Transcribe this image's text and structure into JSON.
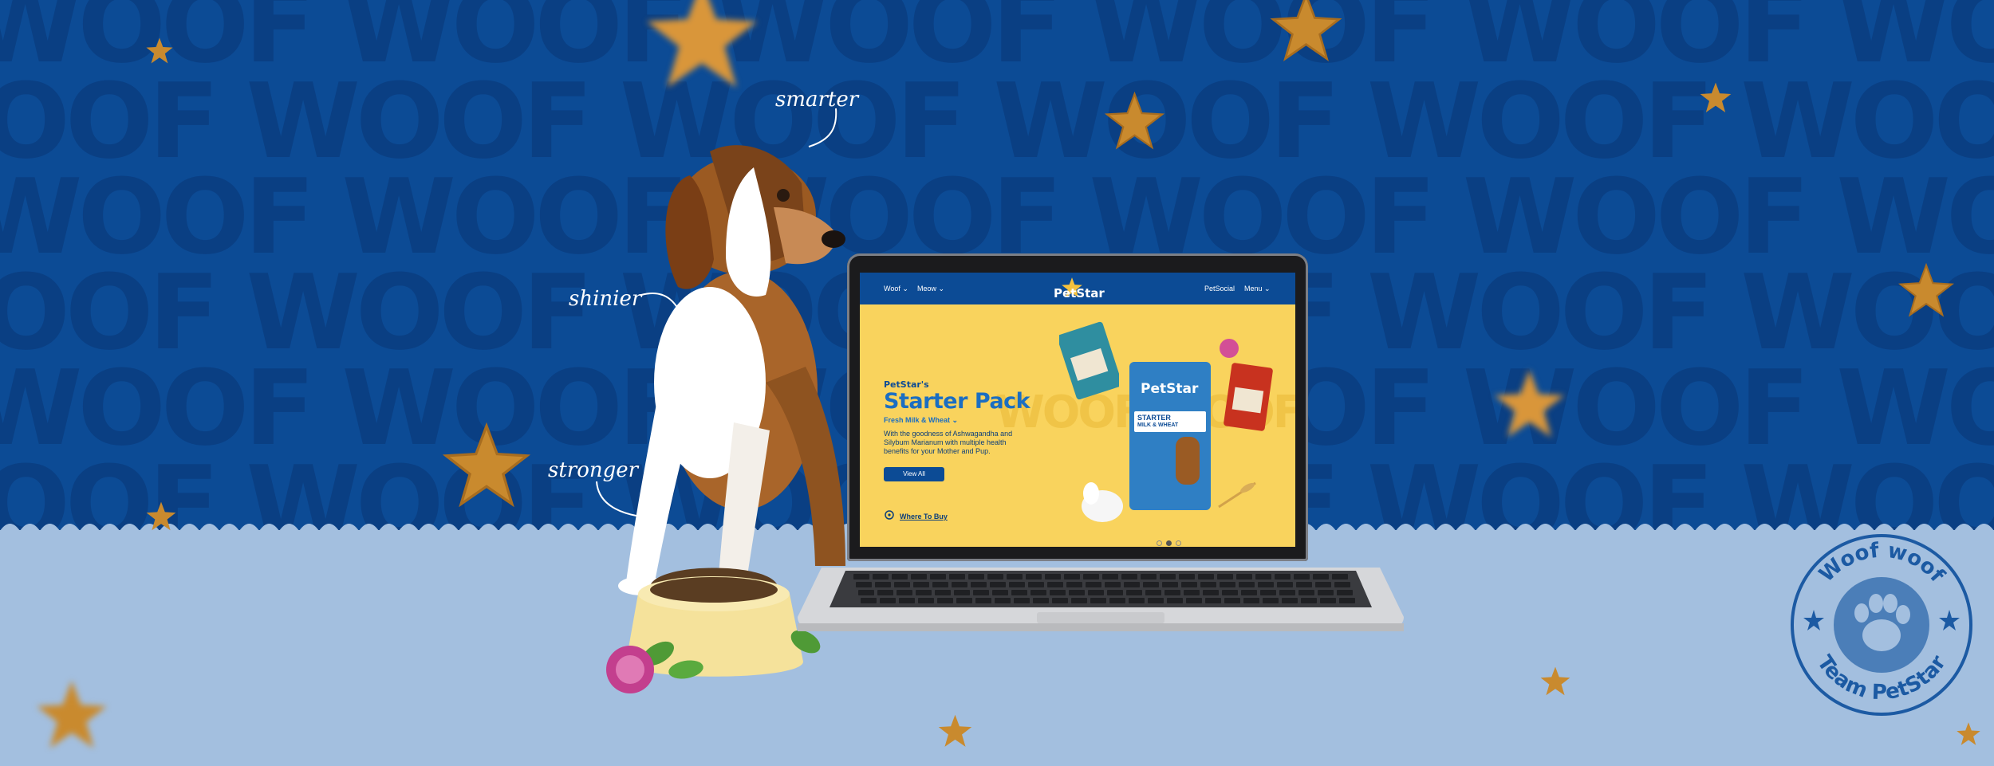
{
  "background": {
    "top_color": "#0c4b95",
    "pattern_color": "#0a3f83",
    "bottom_color": "#a3bfdf",
    "pattern_rows": [
      "WOOF WOOF WOOF WOOF WOOF WOOF WOOF WOOF WOOF WOOF WOOF WOOF WOOF WOOF WOOF WOOF",
      "WOOF WOOF WOOF WOOF WOOF WOOF WOOF WOOF WOOF WOOF WOOF WOOF WOOF WOOF WOOF WOOF",
      "WOOF WOOF WOOF WOOF WOOF WOOF WOOF WOOF WOOF WOOF WOOF WOOF WOOF WOOF WOOF WOOF",
      "WOOF WOOF WOOF WOOF WOOF WOOF WOOF WOOF WOOF WOOF WOOF WOOF WOOF WOOF WOOF WOOF",
      "WOOF WOOF WOOF WOOF WOOF WOOF WOOF WOOF WOOF WOOF WOOF WOOF WOOF WOOF WOOF WOOF",
      "WOOF WOOF WOOF WOOF WOOF WOOF WOOF WOOF WOOF WOOF WOOF WOOF WOOF WOOF WOOF WOOF"
    ]
  },
  "annotations": {
    "smarter": "smarter",
    "shinier": "shinier",
    "stronger": "stronger"
  },
  "website": {
    "nav": {
      "woof": "Woof",
      "meow": "Meow",
      "logo": "PetStar",
      "petsocial": "PetSocial",
      "menu": "Menu"
    },
    "hero": {
      "pretitle": "PetStar's",
      "title": "Starter Pack",
      "subtitle": "Fresh Milk & Wheat",
      "description": "With the goodness of Ashwagandha and Silybum Marianum with multiple health benefits for your Mother and Pup.",
      "button": "View All",
      "where_to_buy": "Where To Buy",
      "background_word": "WOOF WOOF"
    },
    "product": {
      "brand": "PetStar",
      "name": "STARTER",
      "variant": "MILK & WHEAT"
    },
    "carousel": {
      "count": 3,
      "active": 2
    }
  },
  "stamp": {
    "top_text": "Woof woof",
    "bottom_text": "Team PetStar"
  },
  "colors": {
    "brand_blue": "#0c4b95",
    "accent_blue": "#1b6ec2",
    "site_yellow": "#f9d35d",
    "biscuit": "#c98a2e"
  }
}
